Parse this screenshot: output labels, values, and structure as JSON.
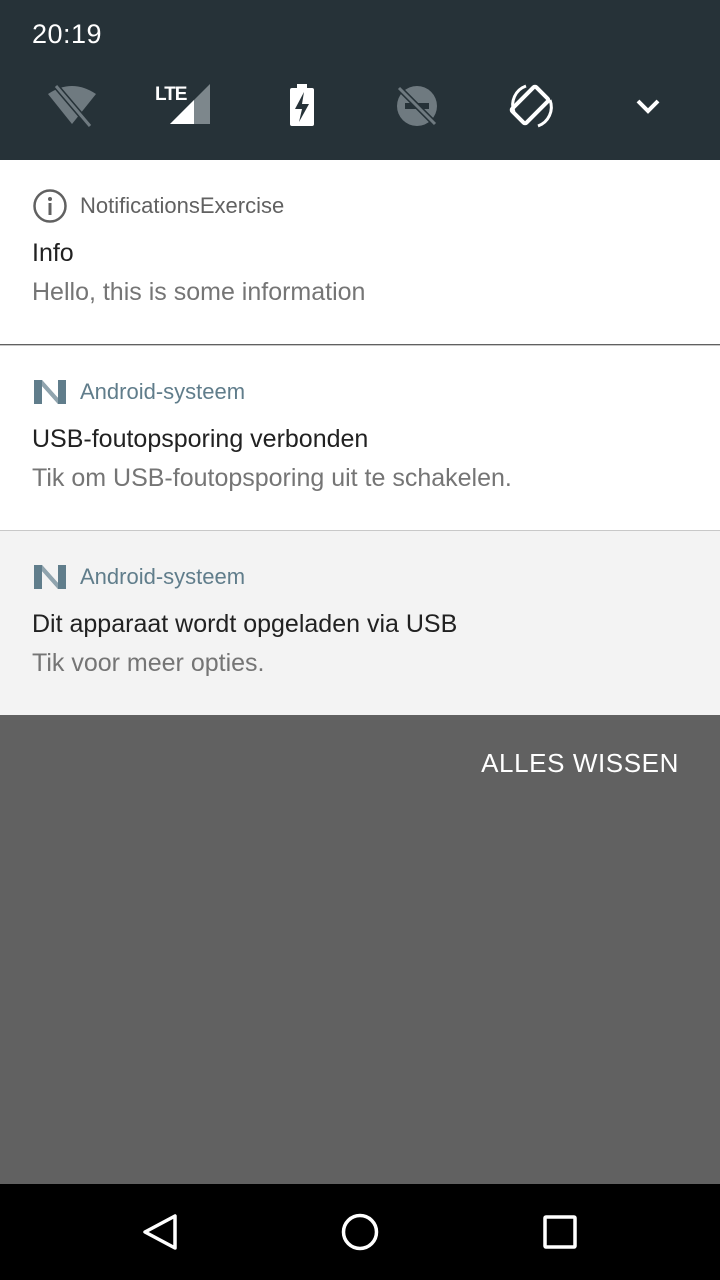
{
  "status_bar": {
    "time": "20:19"
  },
  "quick_settings": {
    "icons": [
      "wifi-off-icon",
      "lte-signal-icon",
      "battery-charging-icon",
      "do-not-disturb-off-icon",
      "auto-rotate-icon",
      "expand-icon"
    ],
    "lte_label": "LTE"
  },
  "notifications": [
    {
      "app": "NotificationsExercise",
      "app_icon": "info-icon",
      "title": "Info",
      "text": "Hello, this is some information"
    },
    {
      "app": "Android-systeem",
      "app_icon": "android-system-icon",
      "title": "USB-foutopsporing verbonden",
      "text": "Tik om USB-foutopsporing uit te schakelen."
    },
    {
      "app": "Android-systeem",
      "app_icon": "android-system-icon",
      "title": "Dit apparaat wordt opgeladen via USB",
      "text": "Tik voor meer opties."
    }
  ],
  "clear_all_label": "ALLES WISSEN",
  "nav_bar": {
    "buttons": [
      "back-icon",
      "home-icon",
      "recents-icon"
    ]
  },
  "colors": {
    "header_bg": "#263238",
    "scrim_bg": "#616161",
    "app_name_info": "#616161",
    "app_name_system": "#607d8b",
    "nav_bg": "#000000"
  }
}
